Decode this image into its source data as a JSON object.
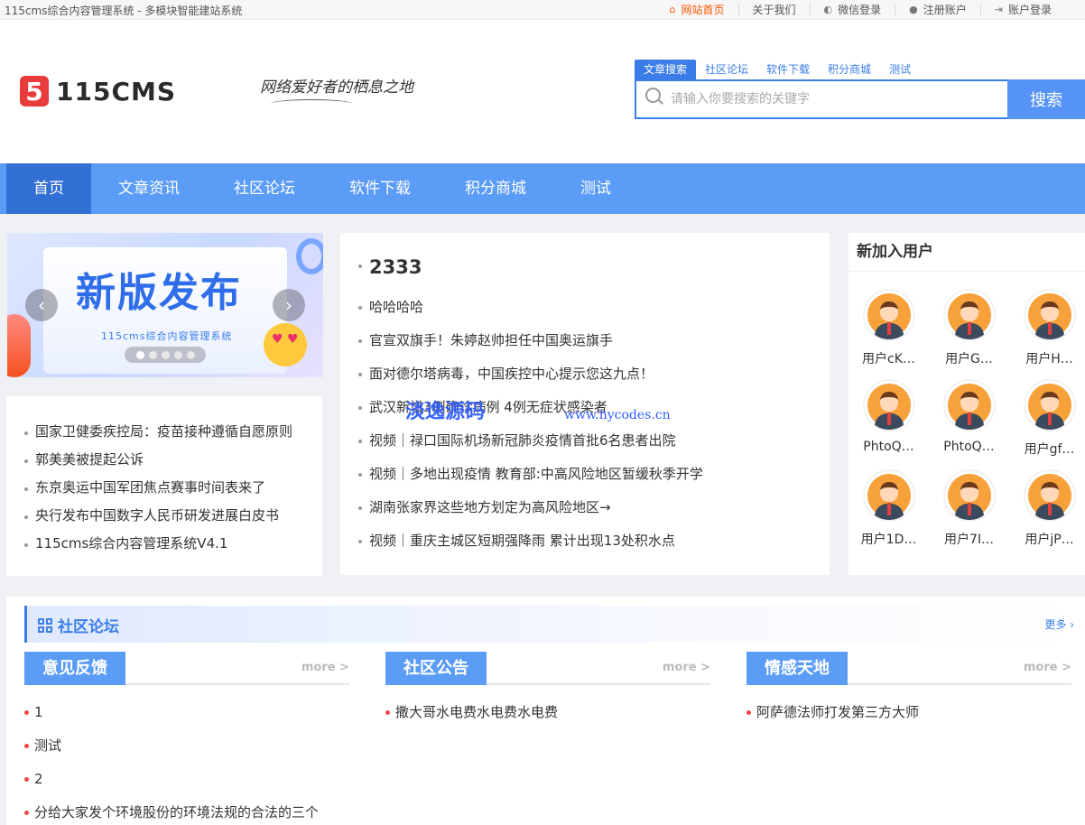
{
  "topbar": {
    "site_name": "115cms综合内容管理系统 - 多模块智能建站系统",
    "links": [
      {
        "label": "网站首页",
        "icon": "home-icon"
      },
      {
        "label": "关于我们",
        "icon": ""
      },
      {
        "label": "微信登录",
        "icon": "wechat-icon"
      },
      {
        "label": "注册账户",
        "icon": "user-icon"
      },
      {
        "label": "账户登录",
        "icon": "login-icon"
      }
    ]
  },
  "header": {
    "logo_mark": "5",
    "logo_text": "115CMS",
    "slogan": "网络爱好者的栖息之地"
  },
  "search": {
    "tabs": [
      "文章搜索",
      "社区论坛",
      "软件下载",
      "积分商城",
      "测试"
    ],
    "placeholder": "请输入你要搜索的关键字",
    "button": "搜索"
  },
  "nav": [
    "首页",
    "文章资讯",
    "社区论坛",
    "软件下载",
    "积分商城",
    "测试"
  ],
  "banner": {
    "title": "新版发布",
    "subtitle": "115cms综合内容管理系统",
    "prev": "‹",
    "next": "›",
    "slide_count": 5,
    "active_slide": 1
  },
  "left_news": [
    "国家卫健委疾控局：疫苗接种遵循自愿原则",
    "郭美美被提起公诉",
    "东京奥运中国军团焦点赛事时间表来了",
    "央行发布中国数字人民币研发进展白皮书",
    "115cms综合内容管理系统V4.1"
  ],
  "mid_news": [
    "2333",
    "哈哈哈哈",
    "官宣双旗手！朱婷赵帅担任中国奥运旗手",
    "面对德尔塔病毒，中国疾控中心提示您这九点！",
    "武汉新增3例确诊病例 4例无症状感染者",
    "视频｜禄口国际机场新冠肺炎疫情首批6名患者出院",
    "视频｜多地出现疫情 教育部:中高风险地区暂缓秋季开学",
    "湖南张家界这些地方划定为高风险地区→",
    "视频｜重庆主城区短期强降雨 累计出现13处积水点"
  ],
  "watermark": {
    "text": "淡逸源码",
    "url": "www.hycodes.cn"
  },
  "users": {
    "title": "新加入用户",
    "list": [
      "用户cK…",
      "用户G…",
      "用户H…",
      "PhtoQ…",
      "PhtoQ…",
      "用户gf…",
      "用户1D…",
      "用户7I…",
      "用户jP…"
    ]
  },
  "forum": {
    "title": "社区论坛",
    "more": "更多",
    "columns": [
      {
        "title": "意见反馈",
        "more": "more >",
        "items": [
          "1",
          "测试",
          "2",
          "分给大家发个环境股份的环境法规的合法的三个"
        ]
      },
      {
        "title": "社区公告",
        "more": "more >",
        "items": [
          "撒大哥水电费水电费水电费"
        ]
      },
      {
        "title": "情感天地",
        "more": "more >",
        "items": [
          "阿萨德法师打发第三方大师"
        ]
      }
    ]
  },
  "colors": {
    "accent": "#5b9cf7",
    "nav_active": "#3270d6",
    "topbar_active": "#ff5500",
    "bullet_red": "#f04545"
  }
}
